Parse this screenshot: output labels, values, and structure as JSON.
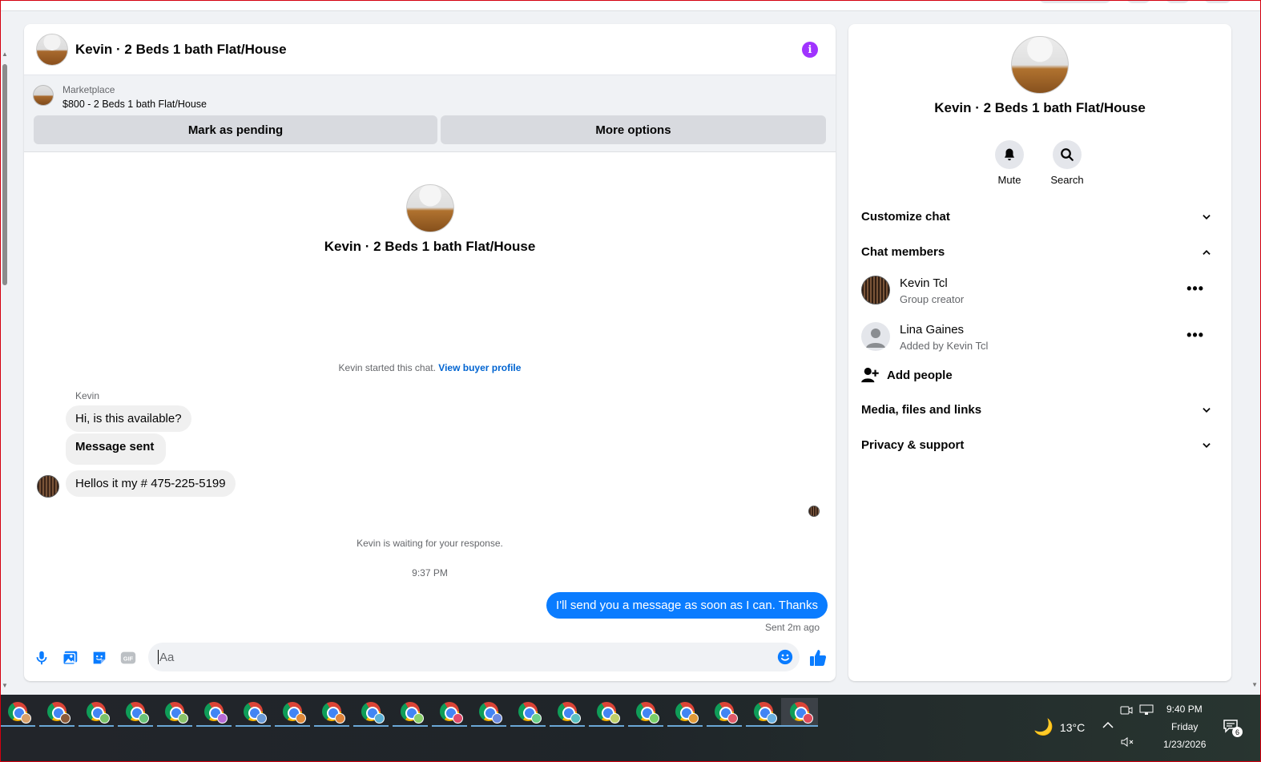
{
  "chat": {
    "title": "Kevin · 2 Beds 1 bath Flat/House",
    "marketplace_label": "Marketplace",
    "listing": "$800 - 2 Beds 1 bath Flat/House",
    "mark_pending": "Mark as pending",
    "more_options": "More options",
    "intro_title": "Kevin · 2 Beds 1 bath Flat/House",
    "started_text": "Kevin started this chat.",
    "view_buyer": "View buyer profile",
    "sender": "Kevin",
    "messages_in": [
      "Hi, is this available?",
      "Message sent",
      "Hellos it my # 475-225-5199"
    ],
    "waiting_text": "Kevin is waiting for your response.",
    "timestamp": "9:37 PM",
    "message_out": "I'll send you a message as soon as I can. Thanks",
    "sent_status": "Sent 2m ago",
    "input_placeholder": "Aa",
    "accent_color": "#0a7cff",
    "info_color": "#a033ff"
  },
  "info": {
    "title": "Kevin · 2 Beds 1 bath Flat/House",
    "mute": "Mute",
    "search": "Search",
    "sections": {
      "customize": "Customize chat",
      "members": "Chat members",
      "media": "Media, files and links",
      "privacy": "Privacy & support"
    },
    "members": [
      {
        "name": "Kevin Tcl",
        "role": "Group creator"
      },
      {
        "name": "Lina Gaines",
        "role": "Added by Kevin Tcl"
      }
    ],
    "add_people": "Add people"
  },
  "taskbar": {
    "icons": "chrome-icon",
    "weather": "13°C",
    "time": "9:40 PM",
    "day": "Friday",
    "date": "1/23/2026",
    "notifications": "6"
  }
}
